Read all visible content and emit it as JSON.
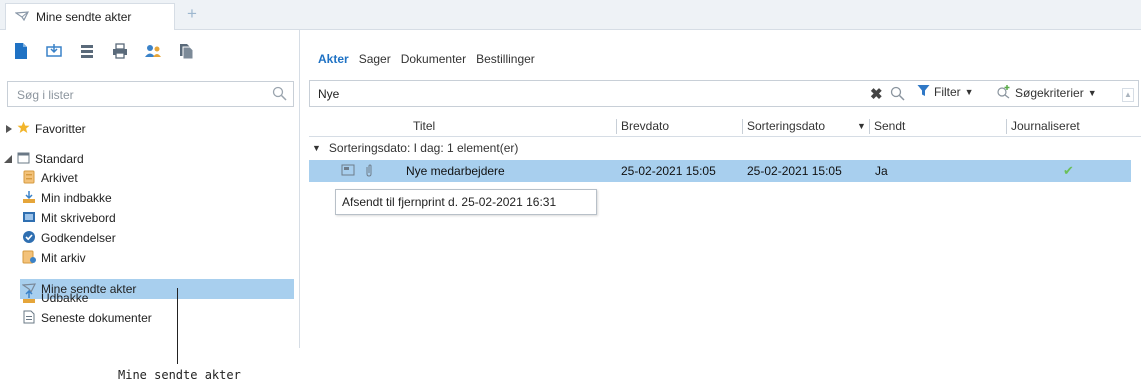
{
  "window": {
    "tab_title": "Mine sendte akter",
    "new_tab_label": "+"
  },
  "left": {
    "toolbar_icons": [
      "new-document-icon",
      "import-icon",
      "list-icon",
      "print-icon",
      "users-icon",
      "copy-icon"
    ],
    "search": {
      "placeholder": "Søg i lister",
      "value": ""
    },
    "favorites_label": "Favoritter",
    "standard_label": "Standard",
    "items": [
      {
        "label": "Arkivet",
        "icon": "archive-icon"
      },
      {
        "label": "Min indbakke",
        "icon": "inbox-icon"
      },
      {
        "label": "Mit skrivebord",
        "icon": "desktop-icon"
      },
      {
        "label": "Godkendelser",
        "icon": "check-circle-icon"
      },
      {
        "label": "Mit arkiv",
        "icon": "my-archive-icon"
      },
      {
        "label": "Mine sendte akter",
        "icon": "sent-icon",
        "selected": true
      },
      {
        "label": "Udbakke",
        "icon": "outbox-icon"
      },
      {
        "label": "Seneste dokumenter",
        "icon": "recent-documents-icon"
      }
    ]
  },
  "right": {
    "tabs": [
      {
        "label": "Akter",
        "active": true
      },
      {
        "label": "Sager"
      },
      {
        "label": "Dokumenter"
      },
      {
        "label": "Bestillinger"
      }
    ],
    "filter": {
      "value": "Nye",
      "filter_label": "Filter",
      "search_criteria_label": "Søgekriterier"
    },
    "columns": [
      "Titel",
      "Brevdato",
      "Sorteringsdato",
      "Sendt",
      "Journaliseret"
    ],
    "group_label": "Sorteringsdato: I dag: 1 element(er)",
    "rows": [
      {
        "title": "Nye medarbejdere",
        "brevdato": "25-02-2021 15:05",
        "sorteringsdato": "25-02-2021 15:05",
        "sendt": "Ja",
        "journaliseret": "✔"
      }
    ],
    "tooltip": "Afsendt til fjernprint d. 25-02-2021 16:31"
  },
  "callout": "Mine sendte akter",
  "colors": {
    "accent": "#1f72c4",
    "selection": "#a8cfee",
    "check": "#6bbf59"
  }
}
